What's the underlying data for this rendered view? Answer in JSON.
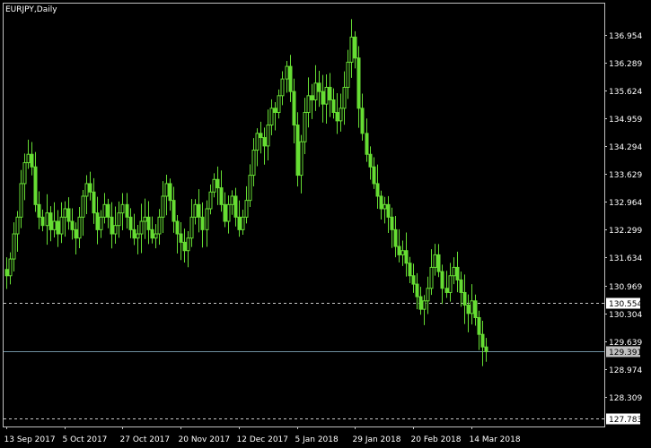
{
  "chart_data": {
    "type": "candlestick",
    "title": "EURJPY,Daily",
    "colors": {
      "background": "#000000",
      "frame": "#c0c0c0",
      "candles": "#66dd33",
      "level_line": "#c8c8c8",
      "current_line": "#7090a0",
      "level_badge_bg": "#ffffff",
      "level_badge_text": "#000000",
      "current_badge_bg": "#c0c0c0",
      "current_badge_text": "#000000"
    },
    "y_ticks": [
      "136.954",
      "136.289",
      "135.624",
      "134.959",
      "134.294",
      "133.629",
      "132.964",
      "132.299",
      "131.634",
      "130.969",
      "130.304",
      "129.639",
      "128.974",
      "128.309"
    ],
    "ylim": [
      127.6,
      137.7
    ],
    "x_ticks": [
      {
        "label": "13 Sep 2017",
        "index": 0
      },
      {
        "label": "5 Oct 2017",
        "index": 16
      },
      {
        "label": "27 Oct 2017",
        "index": 32
      },
      {
        "label": "20 Nov 2017",
        "index": 48
      },
      {
        "label": "12 Dec 2017",
        "index": 64
      },
      {
        "label": "5 Jan 2018",
        "index": 80
      },
      {
        "label": "29 Jan 2018",
        "index": 96
      },
      {
        "label": "20 Feb 2018",
        "index": 112
      },
      {
        "label": "14 Mar 2018",
        "index": 128
      }
    ],
    "reference_lines": [
      {
        "label": "130.554",
        "value": 130.554,
        "style": "dashed"
      },
      {
        "label": "129.391",
        "value": 129.391,
        "style": "solid"
      },
      {
        "label": "127.783",
        "value": 127.783,
        "style": "dashed"
      }
    ],
    "closes": [
      131.2,
      131.6,
      132.2,
      132.6,
      133.4,
      133.9,
      134.1,
      133.8,
      132.9,
      132.6,
      132.4,
      132.7,
      132.3,
      132.5,
      132.2,
      132.6,
      132.8,
      132.5,
      132.3,
      132.1,
      132.6,
      133.1,
      133.4,
      133.2,
      132.7,
      132.3,
      132.6,
      132.9,
      132.6,
      132.2,
      132.4,
      132.7,
      132.9,
      132.6,
      132.3,
      132.1,
      132.2,
      132.5,
      132.6,
      132.3,
      132.1,
      132.2,
      132.6,
      133.1,
      133.4,
      133.0,
      132.5,
      132.2,
      132.0,
      131.8,
      132.1,
      132.6,
      132.9,
      132.6,
      132.3,
      132.8,
      133.2,
      133.5,
      133.3,
      132.9,
      132.5,
      132.9,
      133.1,
      132.6,
      132.3,
      132.6,
      133.0,
      133.6,
      134.2,
      134.6,
      134.5,
      134.3,
      134.8,
      135.2,
      135.1,
      135.5,
      135.9,
      136.2,
      135.6,
      134.8,
      133.6,
      134.4,
      135.1,
      135.5,
      135.4,
      135.8,
      135.6,
      135.3,
      135.7,
      135.4,
      135.1,
      134.9,
      135.2,
      135.7,
      136.3,
      136.9,
      136.4,
      135.2,
      134.6,
      134.1,
      133.8,
      133.4,
      133.1,
      132.8,
      132.9,
      132.6,
      132.3,
      131.9,
      131.7,
      131.8,
      131.5,
      131.2,
      131.0,
      130.7,
      130.4,
      130.6,
      130.9,
      131.4,
      131.7,
      131.3,
      130.9,
      130.8,
      131.2,
      131.4,
      131.1,
      130.8,
      130.5,
      130.3,
      130.6,
      130.2,
      129.8,
      129.5,
      129.39
    ],
    "candle_width_note": "each candle one trading day"
  }
}
